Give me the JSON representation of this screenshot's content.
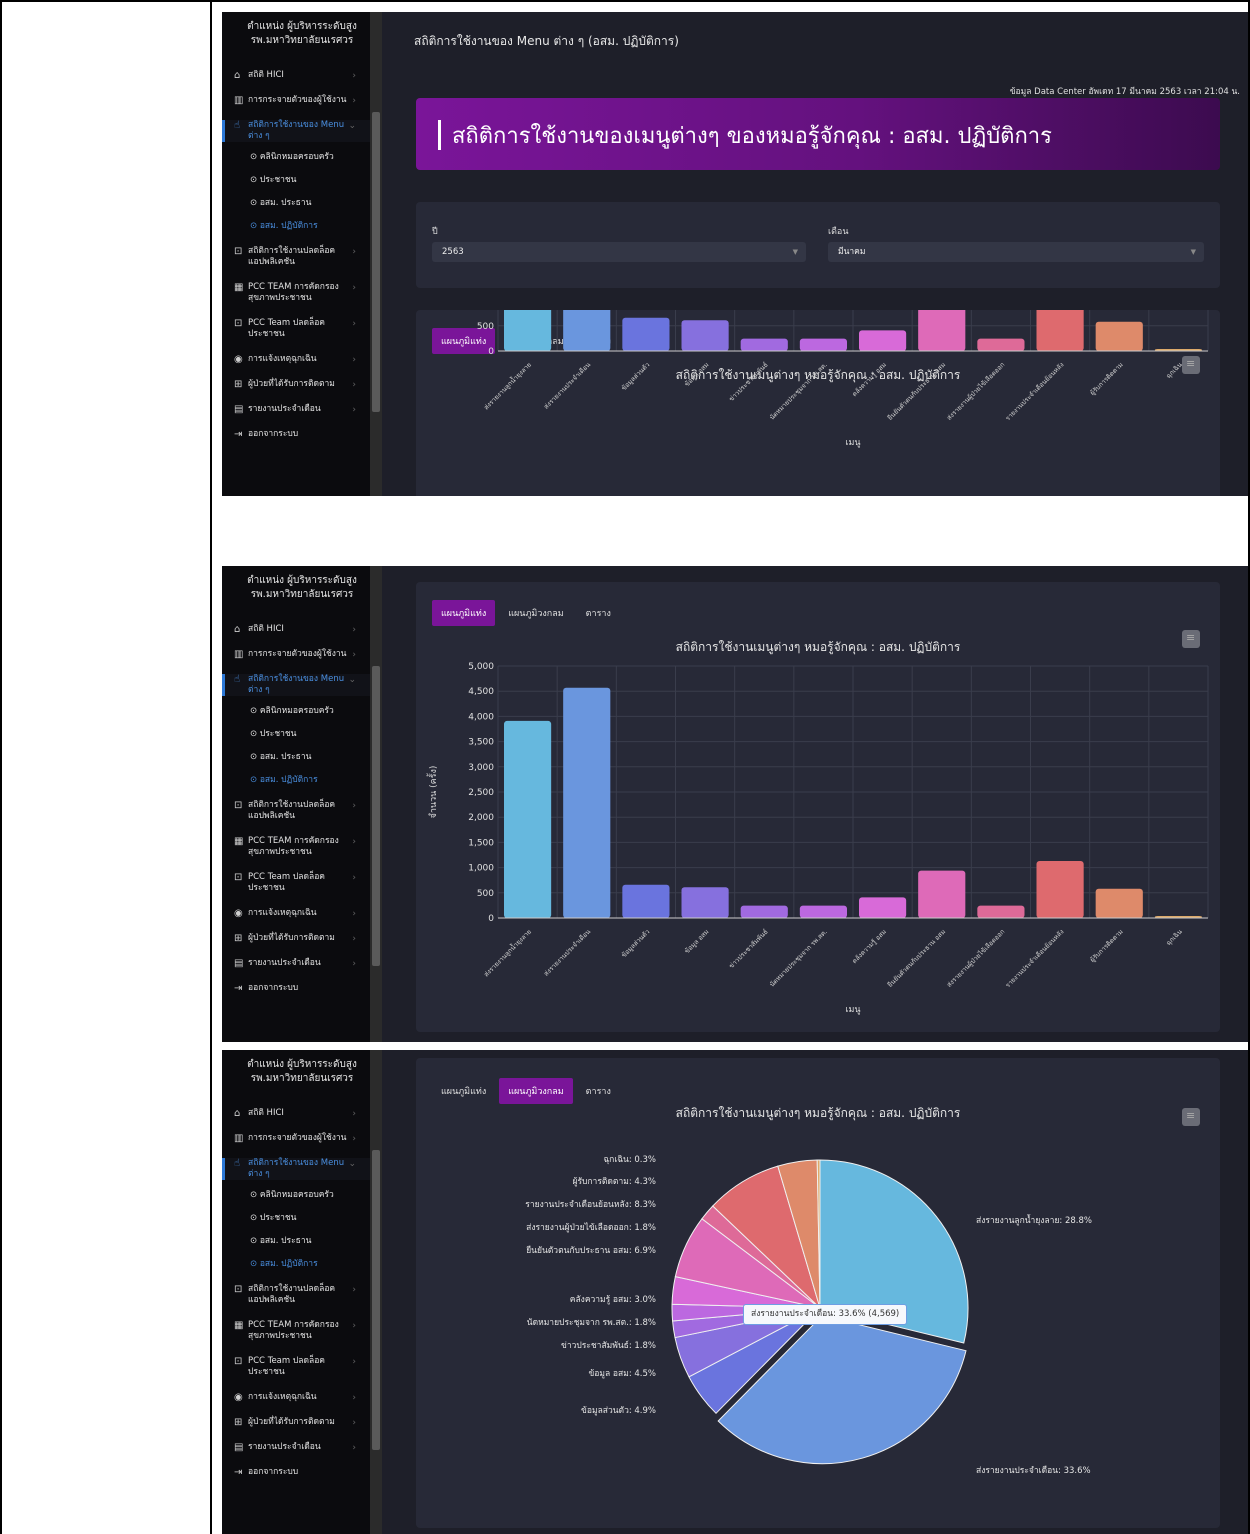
{
  "sidebar": {
    "head_line1": "ตำแหน่ง ผู้บริหารระดับสูง",
    "head_line2": "รพ.มหาวิทยาลัยนเรศวร",
    "items": [
      {
        "label": "สถิติ HICI",
        "icon": "home-icon"
      },
      {
        "label": "การกระจายตัวของผู้ใช้งาน",
        "icon": "map-icon"
      },
      {
        "label": "สถิติการใช้งานของ Menu ต่าง ๆ",
        "icon": "hand-pointer-icon"
      },
      {
        "label": "สถิติการใช้งานปลดล็อคแอปพลิเคชัน",
        "icon": "unlock-icon"
      },
      {
        "label": "PCC TEAM การคัดกรองสุขภาพประชาชน",
        "icon": "grid-icon"
      },
      {
        "label": "PCC Team ปลดล็อคประชาชน",
        "icon": "unlock-icon"
      },
      {
        "label": "การแจ้งเหตุฉุกเฉิน",
        "icon": "alert-icon"
      },
      {
        "label": "ผู้ป่วยที่ได้รับการติดตาม",
        "icon": "medkit-icon"
      },
      {
        "label": "รายงานประจำเดือน",
        "icon": "file-icon"
      },
      {
        "label": "ออกจากระบบ",
        "icon": "logout-icon"
      }
    ],
    "sub_items": [
      "คลินิกหมอครอบครัว",
      "ประชาชน",
      "อสม. ประธาน",
      "อสม. ปฏิบัติการ"
    ]
  },
  "page": {
    "title": "สถิติการใช้งานของ Menu ต่าง ๆ (อสม. ปฏิบัติการ)",
    "updated": "ข้อมูล Data Center อัพเดท 17 มีนาคม 2563 เวลา 21:04 น.",
    "banner": "สถิติการใช้งานของเมนูต่างๆ ของหมอรู้จักคุณ : อสม. ปฏิบัติการ"
  },
  "filters": {
    "year_label": "ปี",
    "year_value": "2563",
    "month_label": "เดือน",
    "month_value": "มีนาคม"
  },
  "tabs": [
    "แผนภูมิแท่ง",
    "แผนภูมิวงกลม",
    "ตาราง"
  ],
  "chart_title": "สถิติการใช้งานเมนูต่างๆ หมอรู้จักคุณ : อสม. ปฏิบัติการ",
  "tooltip": "ส่งรายงานประจำเดือน: 33.6% (4,569)",
  "colors": {
    "accent": "#7a1599",
    "panel": "#1e1f29",
    "card": "#272937"
  },
  "chart_data": [
    {
      "type": "bar",
      "title": "สถิติการใช้งานเมนูต่างๆ หมอรู้จักคุณ : อสม. ปฏิบัติการ",
      "xlabel": "เมนู",
      "ylabel": "จำนวน (ครั้ง)",
      "ylim": [
        0,
        5000
      ],
      "yticks": [
        "0",
        "500",
        "1,000",
        "1,500",
        "2,000",
        "2,500",
        "3,000",
        "3,500",
        "4,000",
        "4,500",
        "5,000"
      ],
      "grid": true,
      "categories": [
        "ส่งรายงานลูกน้ำยุงลาย",
        "ส่งรายงานประจำเดือน",
        "ข้อมูลส่วนตัว",
        "ข้อมูล อสม",
        "ข่าวประชาสัมพันธ์",
        "นัดหมายประชุมจาก รพ.สต.",
        "คลังความรู้ อสม",
        "ยืนยันตัวตนกับประธาน อสม",
        "ส่งรายงานผู้ป่วยไข้เลือดออก",
        "รายงานประจำเดือนย้อนหลัง",
        "ผู้รับการติดตาม",
        "ฉุกเฉิน"
      ],
      "values": [
        3910,
        4569,
        660,
        610,
        245,
        245,
        410,
        940,
        245,
        1130,
        580,
        40
      ],
      "colors": [
        "#66b8de",
        "#6a96de",
        "#6a74de",
        "#8670de",
        "#a16ae0",
        "#bc68e0",
        "#d86ad8",
        "#de6ab8",
        "#de6a98",
        "#de6a6e",
        "#de8a6a",
        "#deaa6a"
      ]
    },
    {
      "type": "pie",
      "title": "สถิติการใช้งานเมนูต่างๆ หมอรู้จักคุณ : อสม. ปฏิบัติการ",
      "slices": [
        {
          "label": "ส่งรายงานลูกน้ำยุงลาย",
          "value": 28.8,
          "display": "ส่งรายงานลูกน้ำยุงลาย: 28.8%",
          "color": "#66b8de"
        },
        {
          "label": "ส่งรายงานประจำเดือน",
          "value": 33.6,
          "display": "ส่งรายงานประจำเดือน: 33.6%",
          "color": "#6a96de"
        },
        {
          "label": "ข้อมูลส่วนตัว",
          "value": 4.9,
          "display": "ข้อมูลส่วนตัว: 4.9%",
          "color": "#6a74de"
        },
        {
          "label": "ข้อมูล อสม",
          "value": 4.5,
          "display": "ข้อมูล อสม: 4.5%",
          "color": "#8670de"
        },
        {
          "label": "ข่าวประชาสัมพันธ์",
          "value": 1.8,
          "display": "ข่าวประชาสัมพันธ์: 1.8%",
          "color": "#a16ae0"
        },
        {
          "label": "นัดหมายประชุมจาก รพ.สต.",
          "value": 1.8,
          "display": "นัดหมายประชุมจาก รพ.สต.: 1.8%",
          "color": "#bc68e0"
        },
        {
          "label": "คลังความรู้ อสม",
          "value": 3.0,
          "display": "คลังความรู้ อสม: 3.0%",
          "color": "#d86ad8"
        },
        {
          "label": "ยืนยันตัวตนกับประธาน อสม",
          "value": 6.9,
          "display": "ยืนยันตัวตนกับประธาน อสม: 6.9%",
          "color": "#de6ab8"
        },
        {
          "label": "ส่งรายงานผู้ป่วยไข้เลือดออก",
          "value": 1.8,
          "display": "ส่งรายงานผู้ป่วยไข้เลือดออก: 1.8%",
          "color": "#de6a98"
        },
        {
          "label": "รายงานประจำเดือนย้อนหลัง",
          "value": 8.3,
          "display": "รายงานประจำเดือนย้อนหลัง: 8.3%",
          "color": "#de6a6e"
        },
        {
          "label": "ผู้รับการติดตาม",
          "value": 4.3,
          "display": "ผู้รับการติดตาม: 4.3%",
          "color": "#de8a6a"
        },
        {
          "label": "ฉุกเฉิน",
          "value": 0.3,
          "display": "ฉุกเฉิน: 0.3%",
          "color": "#deaa6a"
        }
      ]
    }
  ]
}
